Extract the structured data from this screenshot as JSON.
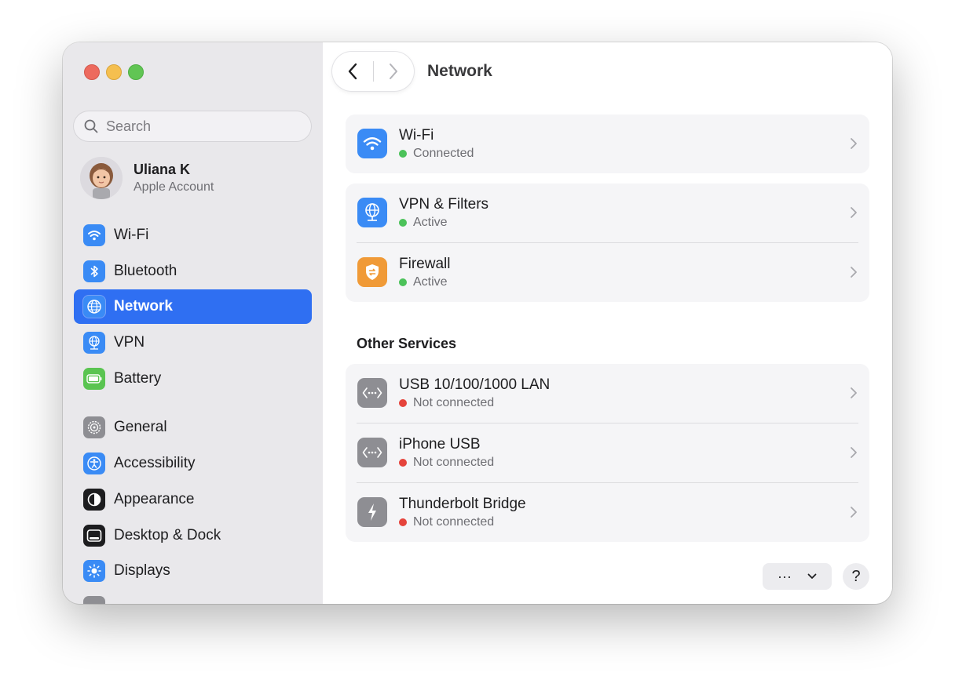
{
  "sidebar": {
    "search": {
      "placeholder": "Search",
      "value": ""
    },
    "account": {
      "name": "Uliana K",
      "subtitle": "Apple Account"
    },
    "items": [
      {
        "label": "Wi-Fi",
        "icon": "wifi-icon",
        "color": "#3a8bf5"
      },
      {
        "label": "Bluetooth",
        "icon": "bluetooth-icon",
        "color": "#3a8bf5"
      },
      {
        "label": "Network",
        "icon": "globe-icon",
        "color": "#3a8bf5",
        "active": true
      },
      {
        "label": "VPN",
        "icon": "vpn-globe-icon",
        "color": "#3a8bf5"
      },
      {
        "label": "Battery",
        "icon": "battery-icon",
        "color": "#5ac451"
      },
      {
        "label": "General",
        "icon": "gear-icon",
        "color": "#8e8e93"
      },
      {
        "label": "Accessibility",
        "icon": "accessibility-icon",
        "color": "#3a8bf5"
      },
      {
        "label": "Appearance",
        "icon": "appearance-icon",
        "color": "#1d1d1f"
      },
      {
        "label": "Desktop & Dock",
        "icon": "dock-icon",
        "color": "#1d1d1f"
      },
      {
        "label": "Displays",
        "icon": "sun-icon",
        "color": "#3a8bf5"
      }
    ]
  },
  "main": {
    "title": "Network",
    "primary": [
      {
        "title": "Wi-Fi",
        "status": "Connected",
        "status_color": "green",
        "icon": "wifi-icon"
      }
    ],
    "security": [
      {
        "title": "VPN & Filters",
        "status": "Active",
        "status_color": "green",
        "icon": "vpn-globe-icon"
      },
      {
        "title": "Firewall",
        "status": "Active",
        "status_color": "green",
        "icon": "firewall-shield-icon"
      }
    ],
    "other_services_title": "Other Services",
    "other_services": [
      {
        "title": "USB 10/100/1000 LAN",
        "status": "Not connected",
        "status_color": "red",
        "icon": "ethernet-icon"
      },
      {
        "title": "iPhone USB",
        "status": "Not connected",
        "status_color": "red",
        "icon": "ethernet-icon"
      },
      {
        "title": "Thunderbolt Bridge",
        "status": "Not connected",
        "status_color": "red",
        "icon": "thunderbolt-icon"
      }
    ],
    "more_button": "···",
    "help_button": "?"
  },
  "colors": {
    "accent": "#2f6ff2",
    "status_green": "#4cc25a",
    "status_red": "#e5443c",
    "firewall_orange": "#f09a37"
  }
}
